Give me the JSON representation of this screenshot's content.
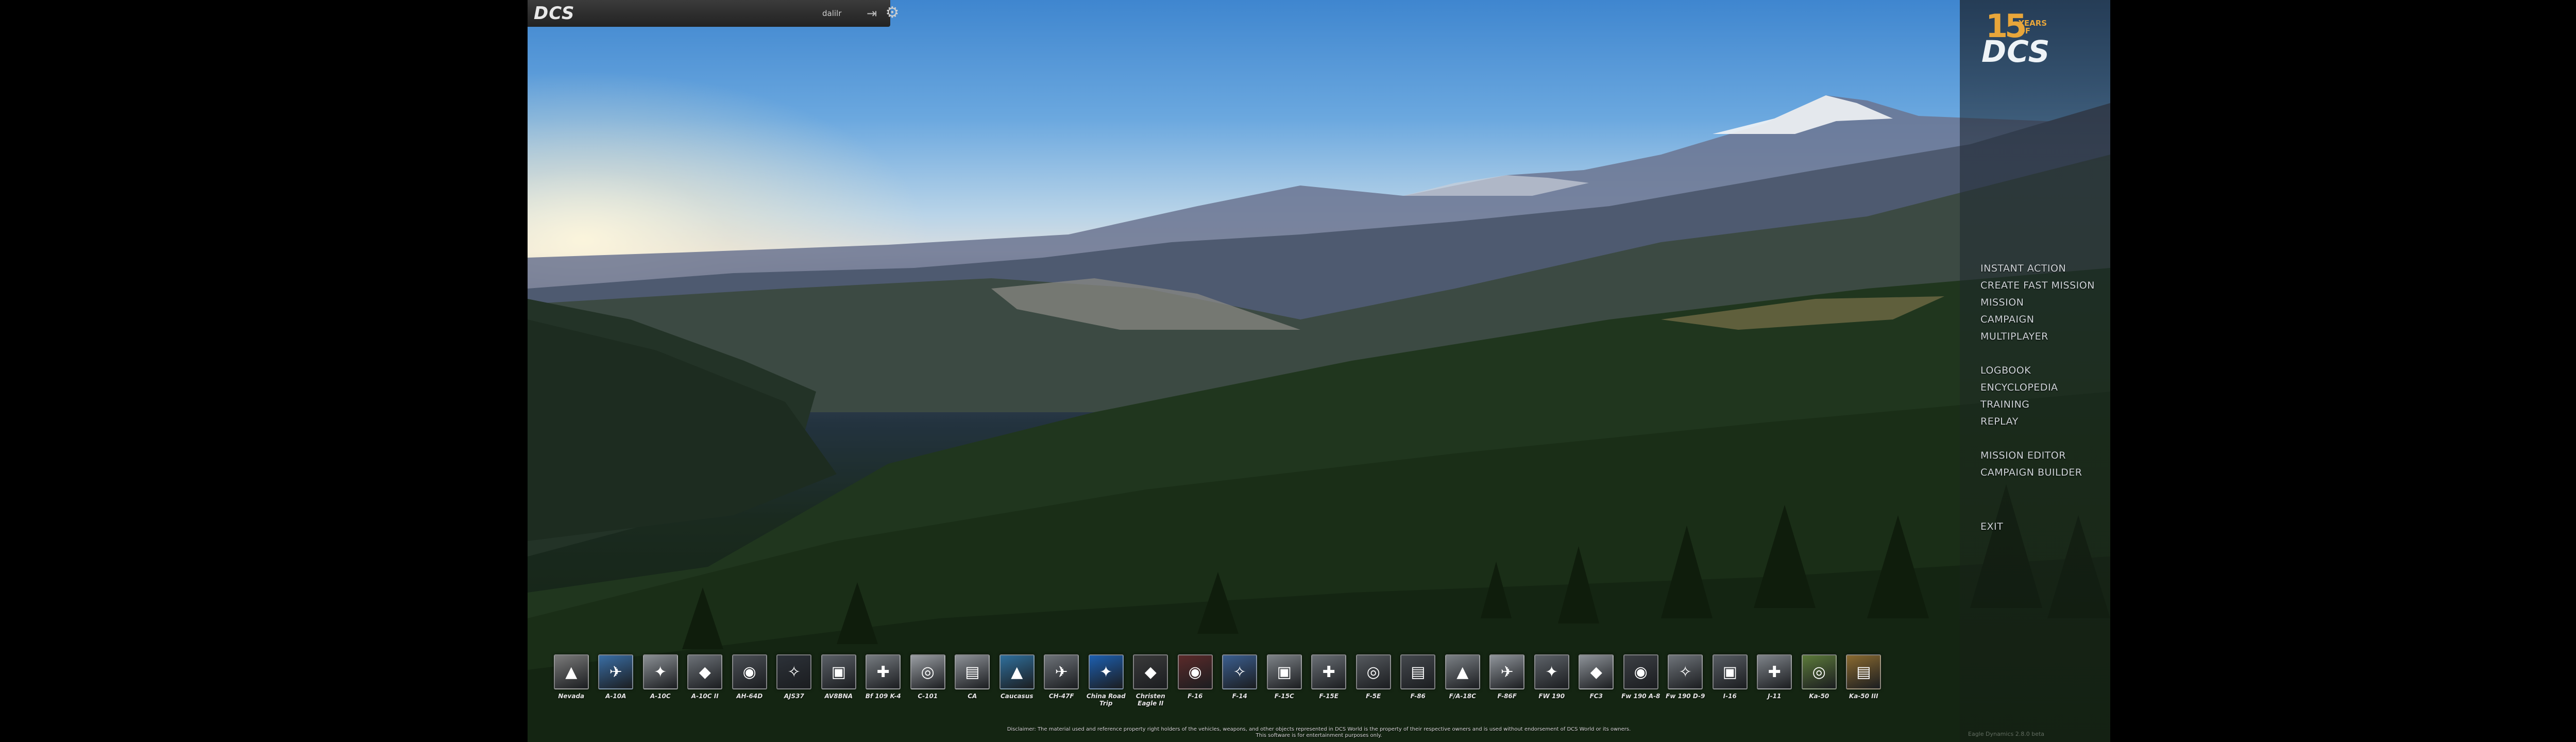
{
  "topbar": {
    "logo": "DCS",
    "username": "dalilr",
    "logout_icon": "logout-icon",
    "settings_icon": "gear-icon"
  },
  "badge": {
    "number": "15",
    "years_line1": "YEARS",
    "years_line2": "OF",
    "brand": "DCS"
  },
  "menu": {
    "group1": [
      "INSTANT ACTION",
      "CREATE FAST MISSION",
      "MISSION",
      "CAMPAIGN",
      "MULTIPLAYER"
    ],
    "group2": [
      "LOGBOOK",
      "ENCYCLOPEDIA",
      "TRAINING",
      "REPLAY"
    ],
    "group3": [
      "MISSION EDITOR",
      "CAMPAIGN BUILDER"
    ],
    "exit": "EXIT"
  },
  "modules": [
    {
      "label": "Nevada",
      "color": "#7a7a7a"
    },
    {
      "label": "A-10A",
      "color": "#3a6ea5"
    },
    {
      "label": "A-10C",
      "color": "#8a8f94"
    },
    {
      "label": "A-10C II",
      "color": "#6c7177"
    },
    {
      "label": "AH-64D",
      "color": "#4b4f55"
    },
    {
      "label": "AJS37",
      "color": "#2c3138"
    },
    {
      "label": "AV8BNA",
      "color": "#5a5f66"
    },
    {
      "label": "Bf 109 K-4",
      "color": "#767b80"
    },
    {
      "label": "C-101",
      "color": "#9a9ea3"
    },
    {
      "label": "CA",
      "color": "#8d9197"
    },
    {
      "label": "Caucasus",
      "color": "#2f6f9c"
    },
    {
      "label": "CH-47F",
      "color": "#6d7278"
    },
    {
      "label": "China Road Trip",
      "color": "#1d5fb0"
    },
    {
      "label": "Christen Eagle II",
      "color": "#3a3a3a"
    },
    {
      "label": "F-16",
      "color": "#5b2a2a"
    },
    {
      "label": "F-14",
      "color": "#3b5e8f"
    },
    {
      "label": "F-15C",
      "color": "#7d8287"
    },
    {
      "label": "F-15E",
      "color": "#6a6f75"
    },
    {
      "label": "F-5E",
      "color": "#55595e"
    },
    {
      "label": "F-86",
      "color": "#44484d"
    },
    {
      "label": "F/A-18C",
      "color": "#7b8085"
    },
    {
      "label": "F-86F",
      "color": "#8f949a"
    },
    {
      "label": "FW 190",
      "color": "#5d6268"
    },
    {
      "label": "FC3",
      "color": "#8d9298"
    },
    {
      "label": "Fw 190 A-8",
      "color": "#3c3f44"
    },
    {
      "label": "Fw 190 D-9",
      "color": "#6f747a"
    },
    {
      "label": "I-16",
      "color": "#575c62"
    },
    {
      "label": "J-11",
      "color": "#7e8389"
    },
    {
      "label": "Ka-50",
      "color": "#5c7a3a"
    },
    {
      "label": "Ka-50 III",
      "color": "#8a6a30"
    }
  ],
  "disclaimer_line1": "Disclaimer: The material used and reference property right holders of the vehicles, weapons, and other objects represented in DCS World is the property of their respective owners and is used without endorsement of DCS World or its owners.",
  "disclaimer_line2": "This software is for entertainment purposes only.",
  "version": "Eagle Dynamics 2.8.0 beta"
}
